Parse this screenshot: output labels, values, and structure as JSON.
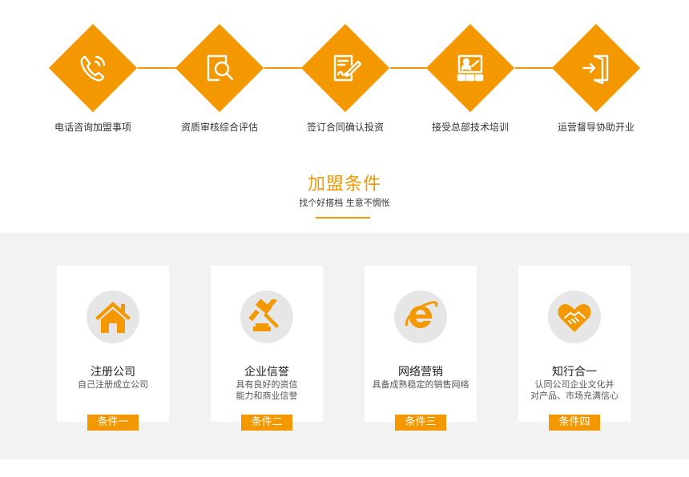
{
  "accent_color": "#f39800",
  "steps": [
    {
      "label": "电话咨询加盟事项",
      "icon": "phone-icon"
    },
    {
      "label": "资质审核综合评估",
      "icon": "search-document-icon"
    },
    {
      "label": "签订合同确认投资",
      "icon": "sign-contract-icon"
    },
    {
      "label": "接受总部技术培训",
      "icon": "training-icon"
    },
    {
      "label": "运营督导协助开业",
      "icon": "door-enter-icon"
    }
  ],
  "section": {
    "title": "加盟条件",
    "subtitle": "找个好搭档 生意不惆怅"
  },
  "conditions": [
    {
      "title": "注册公司",
      "desc": [
        "自己注册成立公司"
      ],
      "badge": "条件一",
      "icon": "house-icon"
    },
    {
      "title": "企业信誉",
      "desc": [
        "具有良好的资信",
        "能力和商业信誉"
      ],
      "badge": "条件二",
      "icon": "gavel-icon"
    },
    {
      "title": "网络营销",
      "desc": [
        "具备成熟稳定的销售网络"
      ],
      "badge": "条件三",
      "icon": "internet-explorer-icon"
    },
    {
      "title": "知行合一",
      "desc": [
        "认同公司企业文化并",
        "对产品、市场充满信心"
      ],
      "badge": "条件四",
      "icon": "handshake-heart-icon"
    }
  ]
}
